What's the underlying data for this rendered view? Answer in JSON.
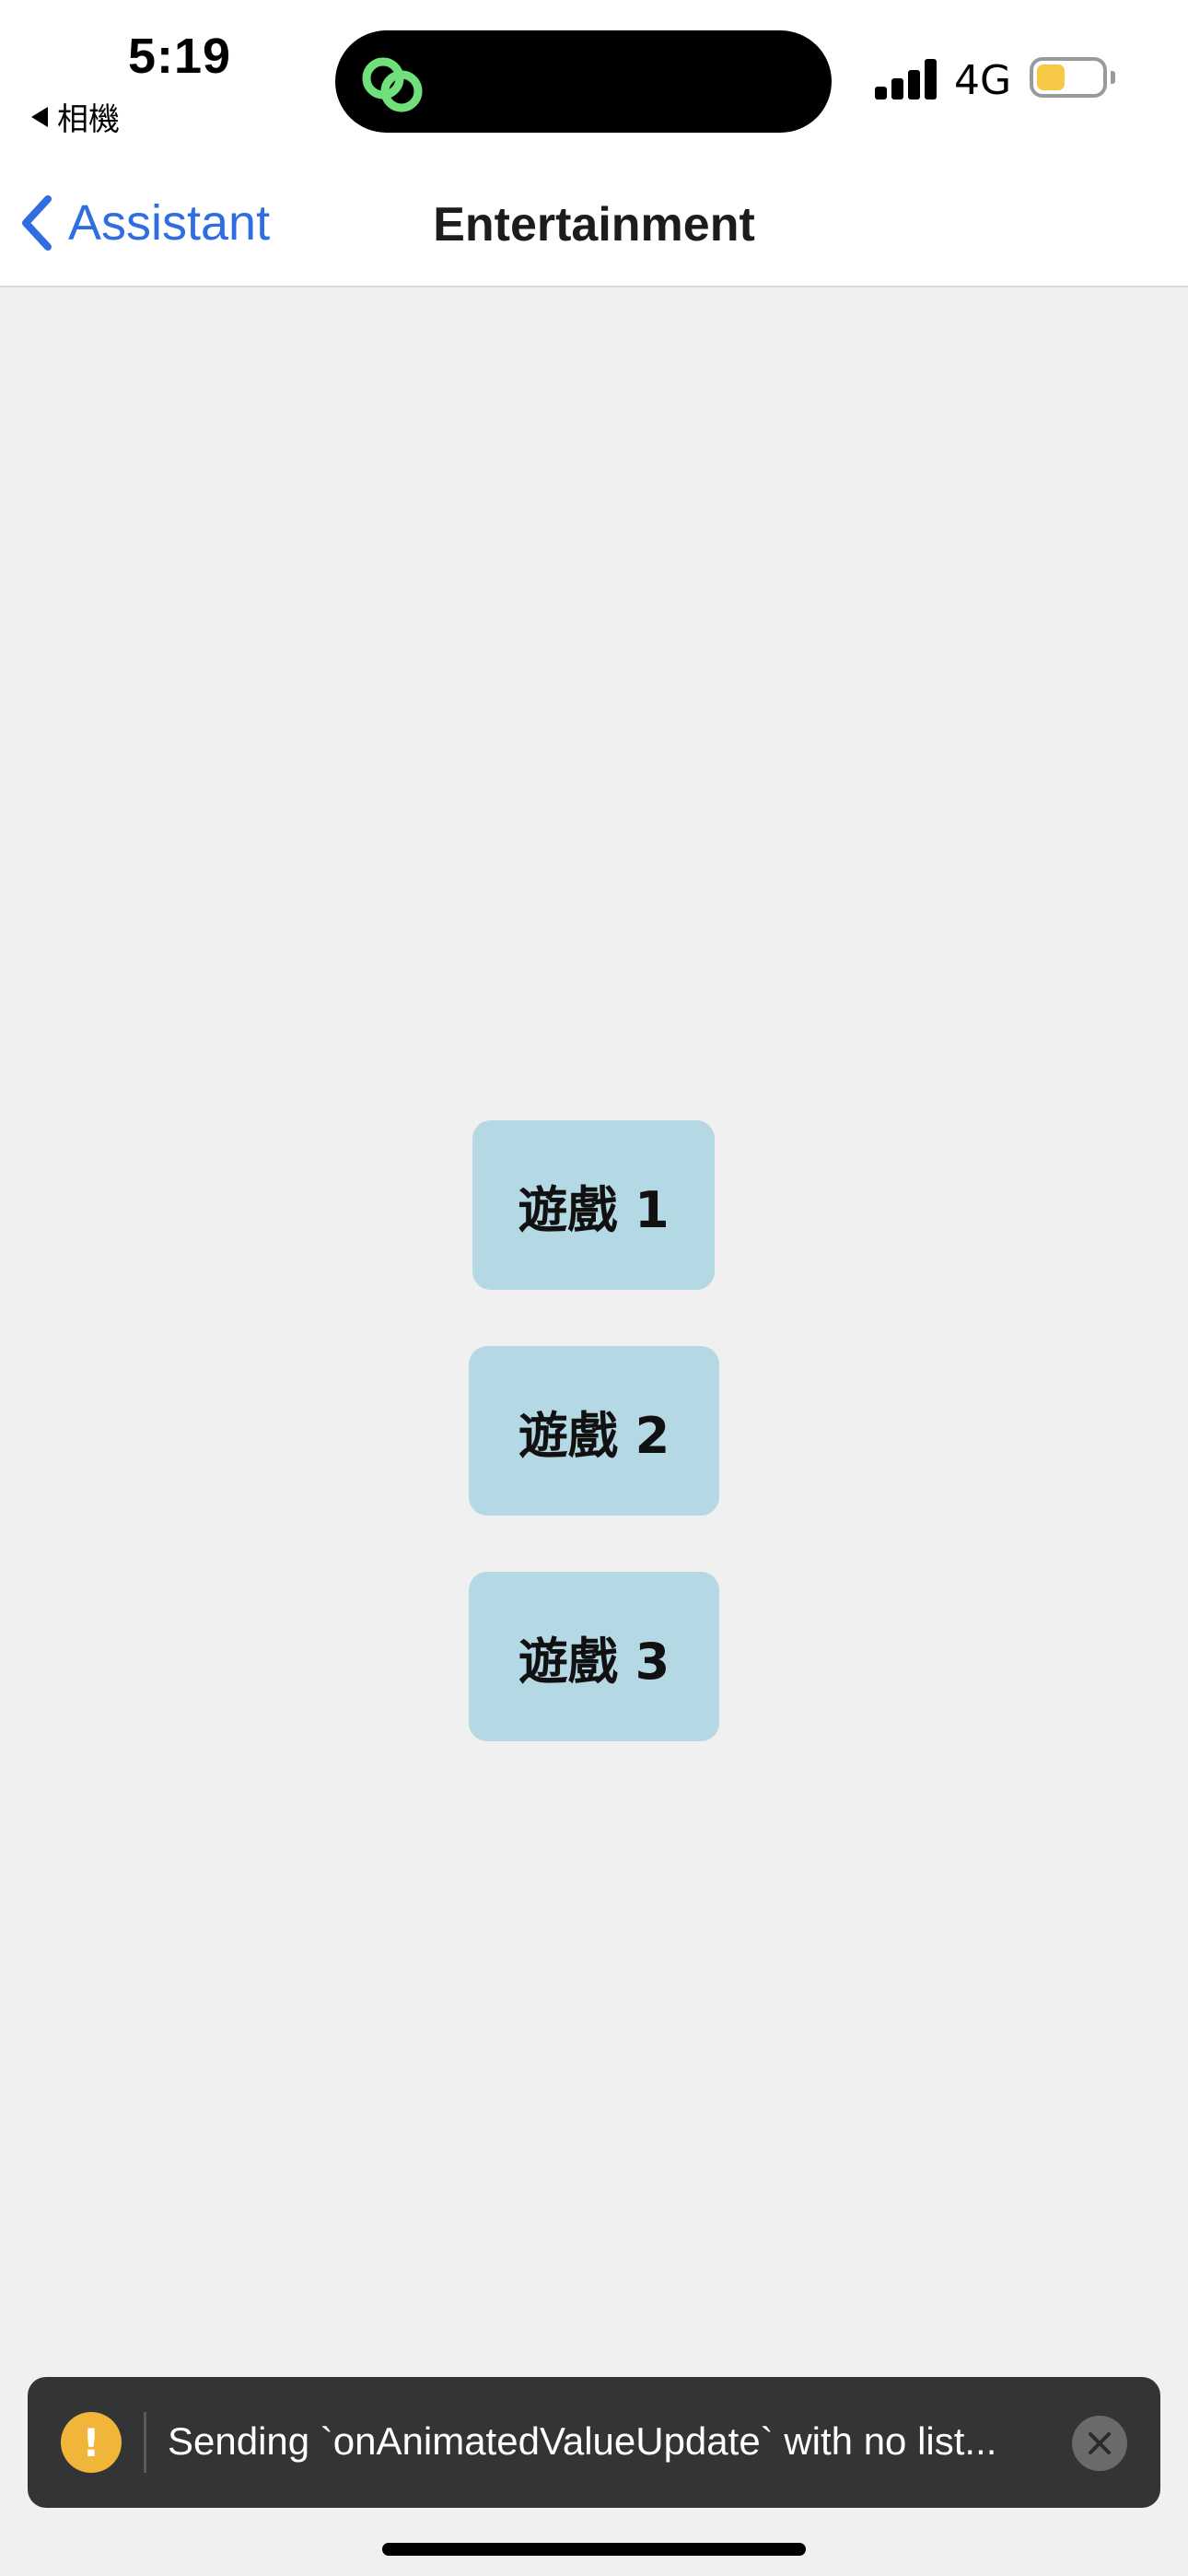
{
  "status_bar": {
    "time": "5:19",
    "back_app": "相機",
    "network": "4G",
    "battery_color": "#f5c945",
    "island_icon": "link-icon",
    "island_icon_color": "#6fe07a"
  },
  "nav": {
    "back_label": "Assistant",
    "title": "Entertainment",
    "accent_color": "#2f6de0"
  },
  "games": [
    {
      "label": "遊戲 1"
    },
    {
      "label": "遊戲 2"
    },
    {
      "label": "遊戲 3"
    }
  ],
  "game_button_color": "#b4d8e4",
  "toast": {
    "icon": "warning-icon",
    "message": "Sending `onAnimatedValueUpdate` with no list...",
    "close_icon": "close-icon"
  }
}
